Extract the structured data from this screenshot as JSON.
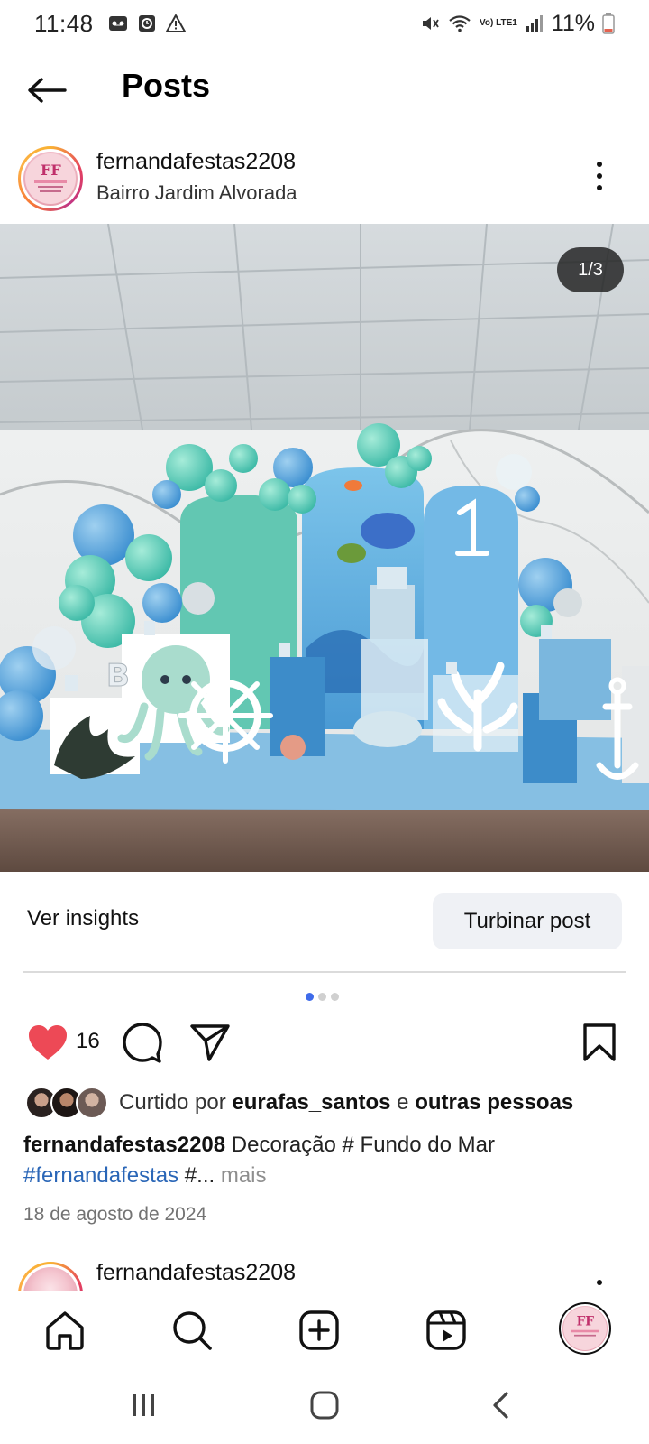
{
  "status_bar": {
    "time": "11:48",
    "battery": "11%",
    "network": "Vo) LTE1"
  },
  "header": {
    "title": "Posts"
  },
  "post": {
    "username": "fernandafestas2208",
    "location": "Bairro Jardim Alvorada",
    "image_counter": "1/3",
    "insights_label": "Ver insights",
    "boost_label": "Turbinar post",
    "carousel_total": 3,
    "carousel_active": 1,
    "likes_count": "16",
    "liked_by_prefix": "Curtido por",
    "liked_by_user": "eurafas_santos",
    "liked_by_connector": "e",
    "liked_by_others": "outras pessoas",
    "caption_user": "fernandafestas2208",
    "caption_text": "Decoração # Fundo do Mar",
    "caption_hashtag": "#fernandafestas",
    "caption_trail": "#...",
    "caption_more": "mais",
    "date": "18 de agosto de 2024"
  },
  "next_post": {
    "username": "fernandafestas2208"
  },
  "colors": {
    "like_red": "#ed4956",
    "hashtag_blue": "#2a66b7",
    "active_dot": "#3f6bea",
    "boost_bg": "#eff1f5"
  },
  "icons": {
    "back": "arrow-left-icon",
    "more": "more-vertical-icon",
    "like": "heart-filled-icon",
    "comment": "comment-icon",
    "share": "send-icon",
    "save": "bookmark-icon",
    "home": "home-icon",
    "search": "search-icon",
    "create": "plus-square-icon",
    "reels": "reels-icon",
    "sys_recents": "recents-icon",
    "sys_home": "home-circle-icon",
    "sys_back": "chevron-left-icon"
  }
}
